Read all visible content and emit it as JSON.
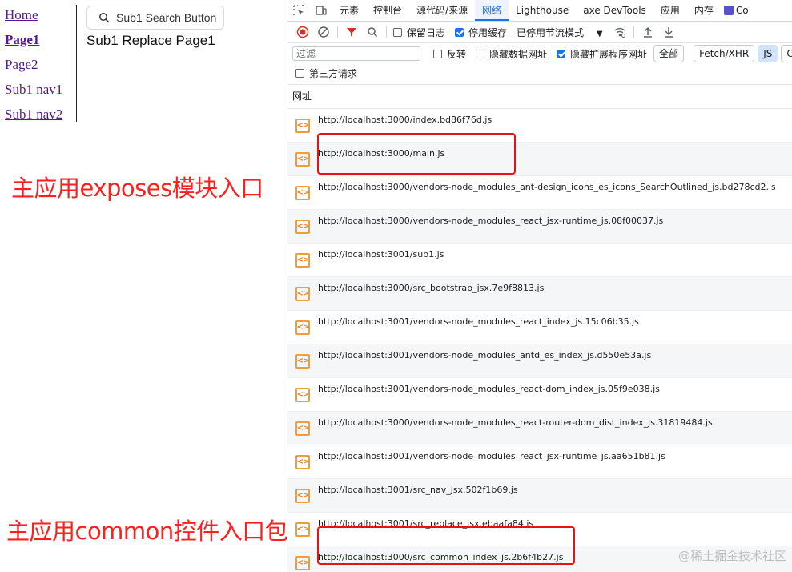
{
  "app": {
    "nav": [
      "Home",
      "Page1",
      "Page2",
      "Sub1 nav1",
      "Sub1 nav2"
    ],
    "active_nav": "Page1",
    "search_button": "Sub1 Search Button",
    "replace_text": "Sub1 Replace Page1"
  },
  "annotations": {
    "exposes": "主应用exposes模块入口",
    "common": "主应用common控件入口包"
  },
  "devtools": {
    "tabs": [
      "元素",
      "控制台",
      "源代码/来源",
      "网络",
      "Lighthouse",
      "axe DevTools",
      "应用",
      "内存",
      "Co"
    ],
    "active_tab": "网络",
    "toolbar": {
      "preserve_log": "保留日志",
      "disable_cache": "停用缓存",
      "throttle": "已停用节流模式"
    },
    "filter": {
      "placeholder": "过滤",
      "invert": "反转",
      "hide_data_urls": "隐藏数据网址",
      "hide_ext_urls": "隐藏扩展程序网址",
      "types": [
        "全部",
        "Fetch/XHR",
        "JS",
        "CSS"
      ],
      "selected_type": "JS",
      "third_party": "第三方请求"
    },
    "column_header": "网址",
    "requests": [
      "http://localhost:3000/index.bd86f76d.js",
      "http://localhost:3000/main.js",
      "http://localhost:3000/vendors-node_modules_ant-design_icons_es_icons_SearchOutlined_js.bd278cd2.js",
      "http://localhost:3000/vendors-node_modules_react_jsx-runtime_js.08f00037.js",
      "http://localhost:3001/sub1.js",
      "http://localhost:3000/src_bootstrap_jsx.7e9f8813.js",
      "http://localhost:3001/vendors-node_modules_react_index_js.15c06b35.js",
      "http://localhost:3001/vendors-node_modules_antd_es_index_js.d550e53a.js",
      "http://localhost:3001/vendors-node_modules_react-dom_index_js.05f9e038.js",
      "http://localhost:3000/vendors-node_modules_react-router-dom_dist_index_js.31819484.js",
      "http://localhost:3001/vendors-node_modules_react_jsx-runtime_js.aa651b81.js",
      "http://localhost:3001/src_nav_jsx.502f1b69.js",
      "http://localhost:3001/src_replace_jsx.ebaafa84.js",
      "http://localhost:3000/src_common_index_js.2b6f4b27.js"
    ]
  },
  "watermark": "@稀土掘金技术社区",
  "colors": {
    "annotation": "#ff1f1f",
    "accent": "#1a73e8",
    "js_icon": "#f29e38"
  }
}
